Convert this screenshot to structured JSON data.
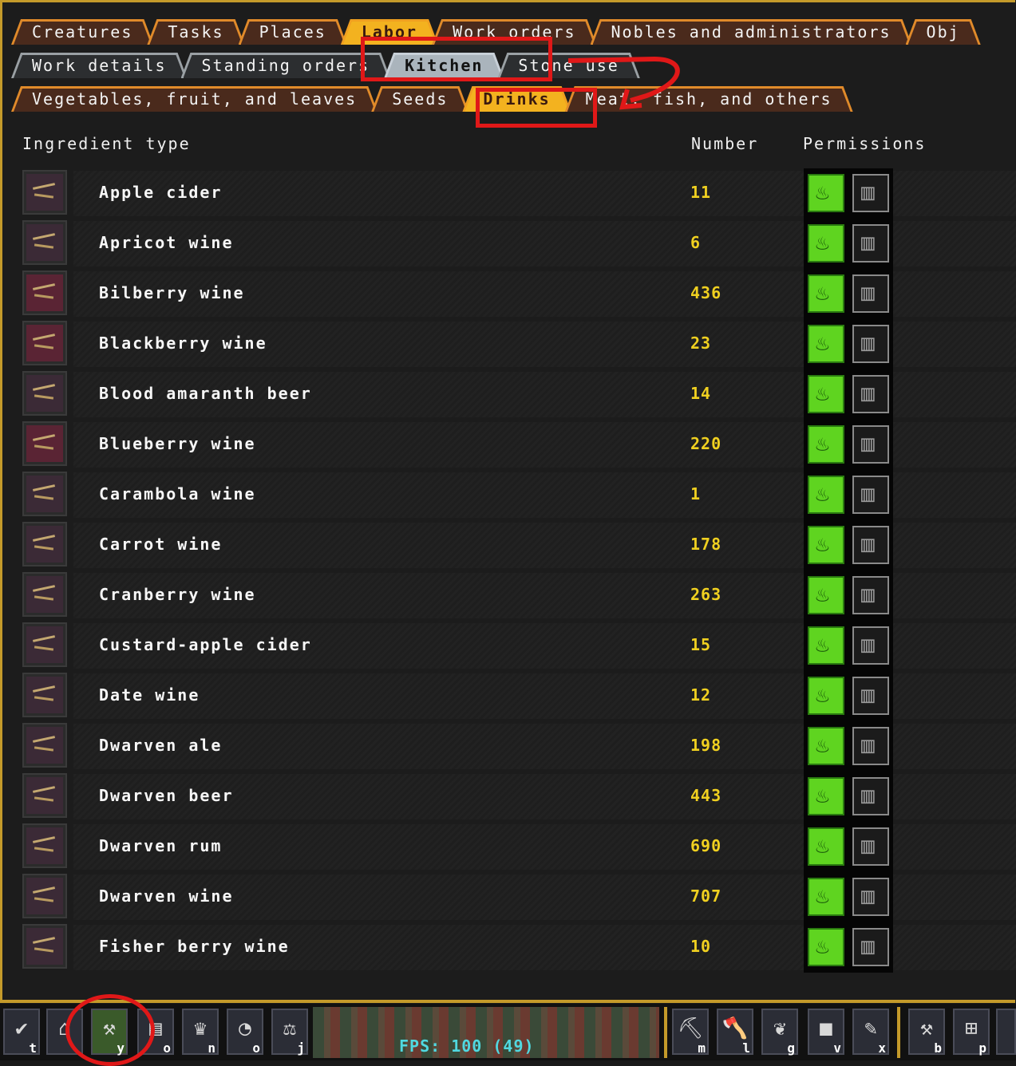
{
  "tabs_top": [
    "Creatures",
    "Tasks",
    "Places",
    "Labor",
    "Work orders",
    "Nobles and administrators",
    "Obj"
  ],
  "tabs_labor": [
    "Work details",
    "Standing orders",
    "Kitchen",
    "Stone use"
  ],
  "tabs_kitchen": [
    "Vegetables, fruit, and leaves",
    "Seeds",
    "Drinks",
    "Meat, fish, and others"
  ],
  "active": {
    "top": "Labor",
    "labor": "Kitchen",
    "kitchen": "Drinks"
  },
  "headers": {
    "ingredient": "Ingredient type",
    "number": "Number",
    "permissions": "Permissions"
  },
  "rows": [
    {
      "name": "Apple cider",
      "number": "11"
    },
    {
      "name": "Apricot wine",
      "number": "6"
    },
    {
      "name": "Bilberry wine",
      "number": "436"
    },
    {
      "name": "Blackberry wine",
      "number": "23"
    },
    {
      "name": "Blood amaranth beer",
      "number": "14"
    },
    {
      "name": "Blueberry wine",
      "number": "220"
    },
    {
      "name": "Carambola wine",
      "number": "1"
    },
    {
      "name": "Carrot wine",
      "number": "178"
    },
    {
      "name": "Cranberry wine",
      "number": "263"
    },
    {
      "name": "Custard-apple cider",
      "number": "15"
    },
    {
      "name": "Date wine",
      "number": "12"
    },
    {
      "name": "Dwarven ale",
      "number": "198"
    },
    {
      "name": "Dwarven beer",
      "number": "443"
    },
    {
      "name": "Dwarven rum",
      "number": "690"
    },
    {
      "name": "Dwarven wine",
      "number": "707"
    },
    {
      "name": "Fisher berry wine",
      "number": "10"
    }
  ],
  "toolbar": {
    "keys": [
      "t",
      "",
      "y",
      "o",
      "n",
      "o",
      "j"
    ],
    "right_keys": [
      "m",
      "l",
      "g",
      "v",
      "x",
      "b",
      "p"
    ],
    "fps": "FPS: 100 (49)"
  },
  "colors": {
    "frame": "#c49a2a",
    "number": "#f0d020",
    "permit": "#5fd420",
    "annotation": "#e01818"
  }
}
